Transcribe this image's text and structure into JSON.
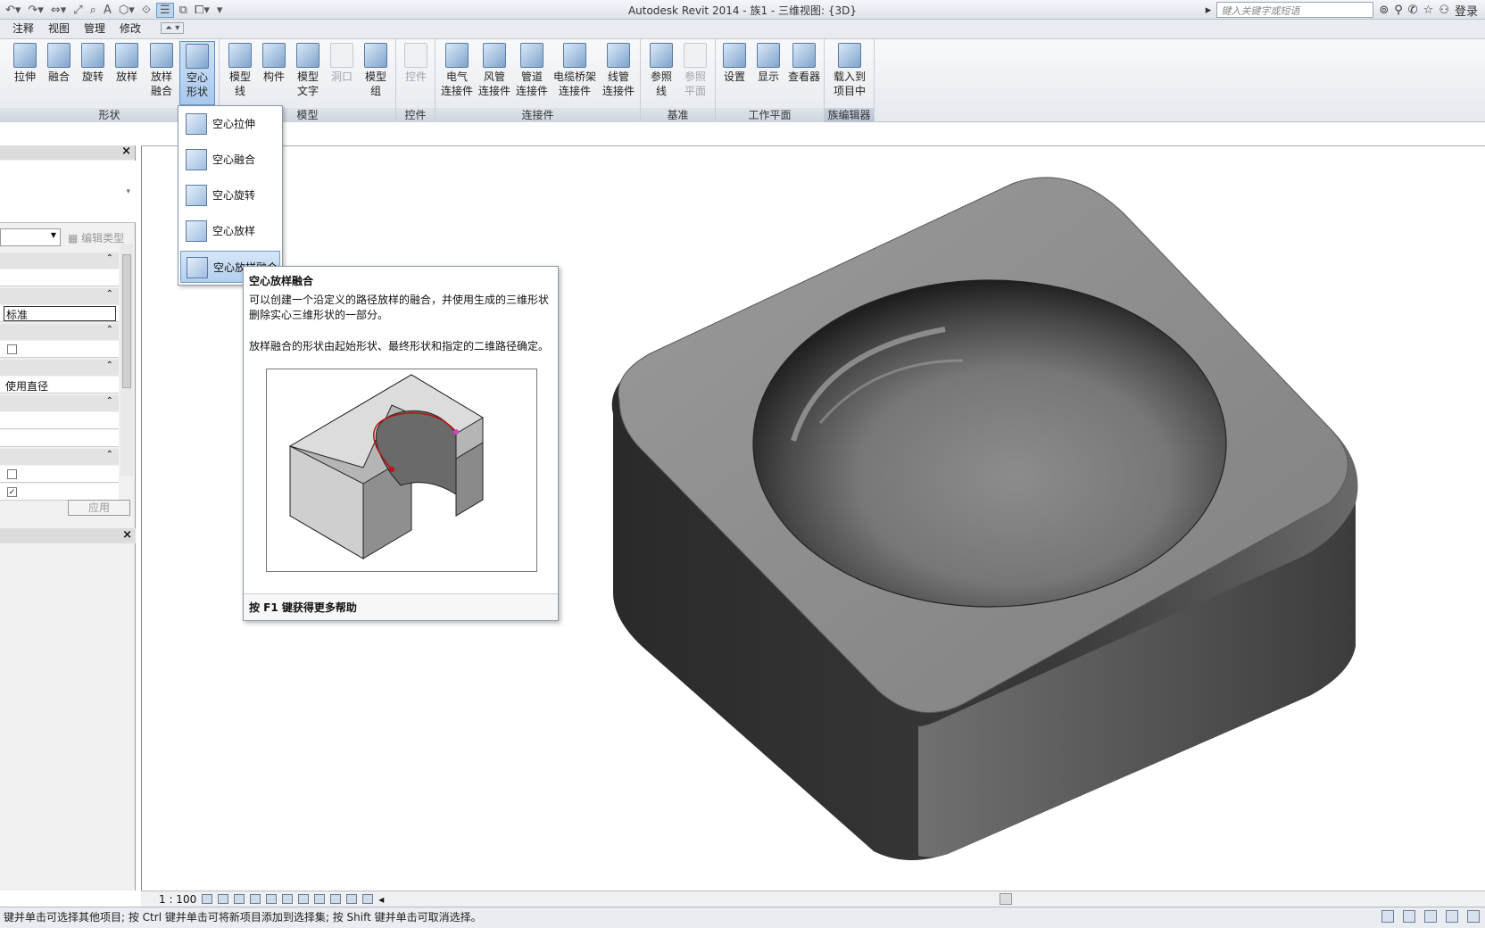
{
  "titlebar": {
    "title": "Autodesk Revit 2014 -    族1 - 三维视图: {3D}",
    "search_placeholder": "键入关键字或短语",
    "login": "登录"
  },
  "tabs": [
    {
      "label": "注释"
    },
    {
      "label": "视图"
    },
    {
      "label": "管理"
    },
    {
      "label": "修改"
    }
  ],
  "ribbon": {
    "shape_panel": {
      "title": "形状",
      "buttons": [
        {
          "label": "拉伸"
        },
        {
          "label": "融合"
        },
        {
          "label": "旋转"
        },
        {
          "label": "放样"
        },
        {
          "label": "放样\n融合"
        },
        {
          "label": "空心\n形状"
        }
      ]
    },
    "model_panel": {
      "title": "模型",
      "buttons": [
        {
          "label": "模型\n线"
        },
        {
          "label": "构件"
        },
        {
          "label": "模型\n文字"
        },
        {
          "label": "洞口"
        },
        {
          "label": "模型\n组"
        }
      ]
    },
    "control_panel": {
      "title": "控件",
      "buttons": [
        {
          "label": "控件"
        }
      ]
    },
    "connector_panel": {
      "title": "连接件",
      "buttons": [
        {
          "label": "电气\n连接件"
        },
        {
          "label": "风管\n连接件"
        },
        {
          "label": "管道\n连接件"
        },
        {
          "label": "电缆桥架\n连接件"
        },
        {
          "label": "线管\n连接件"
        }
      ]
    },
    "datum_panel": {
      "title": "基准",
      "buttons": [
        {
          "label": "参照\n线"
        },
        {
          "label": "参照\n平面"
        }
      ]
    },
    "workplane_panel": {
      "title": "工作平面",
      "buttons": [
        {
          "label": "设置"
        },
        {
          "label": "显示"
        },
        {
          "label": "查看器"
        }
      ]
    },
    "family_editor_panel": {
      "title": "族编辑器",
      "buttons": [
        {
          "label": "载入到\n项目中"
        }
      ]
    }
  },
  "dropdown": {
    "items": [
      {
        "label": "空心拉伸"
      },
      {
        "label": "空心融合"
      },
      {
        "label": "空心旋转"
      },
      {
        "label": "空心放样"
      },
      {
        "label": "空心放样融合"
      }
    ]
  },
  "tooltip": {
    "title": "空心放样融合",
    "desc1": "可以创建一个沿定义的路径放样的融合，并使用生成的三维形状删除实心三维形状的一部分。",
    "desc2": "放样融合的形状由起始形状、最终形状和指定的二维路径确定。",
    "footer": "按 F1 键获得更多帮助"
  },
  "properties": {
    "edit_type": "编辑类型",
    "value_standard": "标准",
    "value_diameter": "使用直径",
    "apply": "应用",
    "checkbox_checked": "✓"
  },
  "viewbar": {
    "scale": "1 : 100"
  },
  "status": {
    "text": "键并单击可选择其他项目; 按 Ctrl 键并单击可将新项目添加到选择集; 按 Shift 键并单击可取消选择。"
  },
  "colors": {
    "accent": "#6b97c9",
    "model_top": "#8a8a8a",
    "model_side": "#2e2e2e"
  }
}
